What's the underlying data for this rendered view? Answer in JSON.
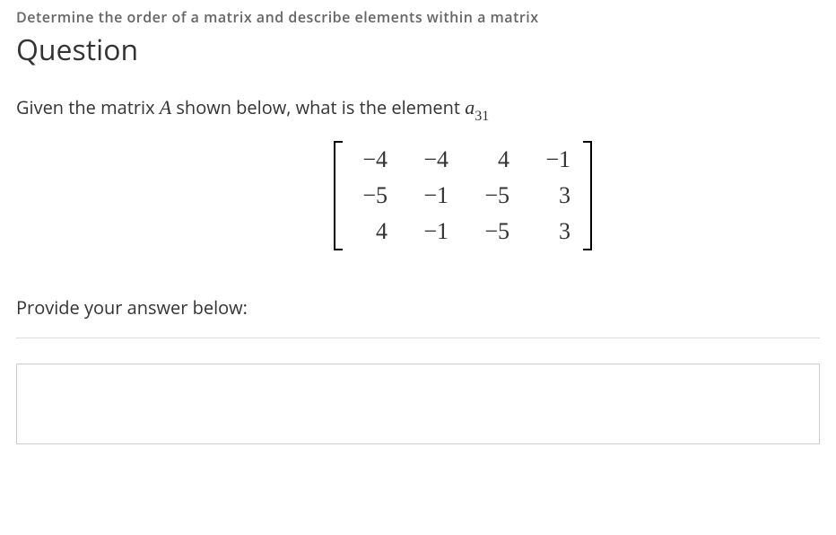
{
  "topic": "Determine the order of a matrix and describe elements within a matrix",
  "heading": "Question",
  "question": {
    "prefix": "Given the matrix ",
    "matrix_name": "A",
    "middle": " shown below, what is the element ",
    "element_var": "a",
    "element_sub": "31"
  },
  "matrix": {
    "rows": [
      [
        "−4",
        "−4",
        "4",
        "−1"
      ],
      [
        "−5",
        "−1",
        "−5",
        "3"
      ],
      [
        "4",
        "−1",
        "−5",
        "3"
      ]
    ]
  },
  "prompt": "Provide your answer below:",
  "answer": {
    "value": "",
    "placeholder": ""
  }
}
